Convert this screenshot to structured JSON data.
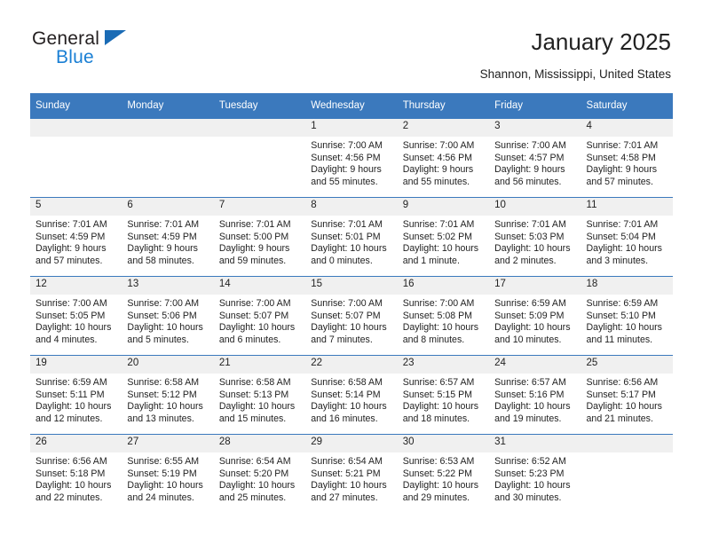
{
  "brand": {
    "name_top": "General",
    "name_bottom": "Blue",
    "accent_color": "#1a7fd4",
    "triangle_color": "#1a6bb5"
  },
  "header": {
    "title": "January 2025",
    "subtitle": "Shannon, Mississippi, United States"
  },
  "calendar": {
    "header_bg": "#3b79bd",
    "daynum_band_bg": "#f0f0f0",
    "weekday_headers": [
      "Sunday",
      "Monday",
      "Tuesday",
      "Wednesday",
      "Thursday",
      "Friday",
      "Saturday"
    ],
    "weeks": [
      [
        {
          "day": "",
          "empty": true
        },
        {
          "day": "",
          "empty": true
        },
        {
          "day": "",
          "empty": true
        },
        {
          "day": "1",
          "sunrise": "Sunrise: 7:00 AM",
          "sunset": "Sunset: 4:56 PM",
          "daylight_line1": "Daylight: 9 hours",
          "daylight_line2": "and 55 minutes."
        },
        {
          "day": "2",
          "sunrise": "Sunrise: 7:00 AM",
          "sunset": "Sunset: 4:56 PM",
          "daylight_line1": "Daylight: 9 hours",
          "daylight_line2": "and 55 minutes."
        },
        {
          "day": "3",
          "sunrise": "Sunrise: 7:00 AM",
          "sunset": "Sunset: 4:57 PM",
          "daylight_line1": "Daylight: 9 hours",
          "daylight_line2": "and 56 minutes."
        },
        {
          "day": "4",
          "sunrise": "Sunrise: 7:01 AM",
          "sunset": "Sunset: 4:58 PM",
          "daylight_line1": "Daylight: 9 hours",
          "daylight_line2": "and 57 minutes."
        }
      ],
      [
        {
          "day": "5",
          "sunrise": "Sunrise: 7:01 AM",
          "sunset": "Sunset: 4:59 PM",
          "daylight_line1": "Daylight: 9 hours",
          "daylight_line2": "and 57 minutes."
        },
        {
          "day": "6",
          "sunrise": "Sunrise: 7:01 AM",
          "sunset": "Sunset: 4:59 PM",
          "daylight_line1": "Daylight: 9 hours",
          "daylight_line2": "and 58 minutes."
        },
        {
          "day": "7",
          "sunrise": "Sunrise: 7:01 AM",
          "sunset": "Sunset: 5:00 PM",
          "daylight_line1": "Daylight: 9 hours",
          "daylight_line2": "and 59 minutes."
        },
        {
          "day": "8",
          "sunrise": "Sunrise: 7:01 AM",
          "sunset": "Sunset: 5:01 PM",
          "daylight_line1": "Daylight: 10 hours",
          "daylight_line2": "and 0 minutes."
        },
        {
          "day": "9",
          "sunrise": "Sunrise: 7:01 AM",
          "sunset": "Sunset: 5:02 PM",
          "daylight_line1": "Daylight: 10 hours",
          "daylight_line2": "and 1 minute."
        },
        {
          "day": "10",
          "sunrise": "Sunrise: 7:01 AM",
          "sunset": "Sunset: 5:03 PM",
          "daylight_line1": "Daylight: 10 hours",
          "daylight_line2": "and 2 minutes."
        },
        {
          "day": "11",
          "sunrise": "Sunrise: 7:01 AM",
          "sunset": "Sunset: 5:04 PM",
          "daylight_line1": "Daylight: 10 hours",
          "daylight_line2": "and 3 minutes."
        }
      ],
      [
        {
          "day": "12",
          "sunrise": "Sunrise: 7:00 AM",
          "sunset": "Sunset: 5:05 PM",
          "daylight_line1": "Daylight: 10 hours",
          "daylight_line2": "and 4 minutes."
        },
        {
          "day": "13",
          "sunrise": "Sunrise: 7:00 AM",
          "sunset": "Sunset: 5:06 PM",
          "daylight_line1": "Daylight: 10 hours",
          "daylight_line2": "and 5 minutes."
        },
        {
          "day": "14",
          "sunrise": "Sunrise: 7:00 AM",
          "sunset": "Sunset: 5:07 PM",
          "daylight_line1": "Daylight: 10 hours",
          "daylight_line2": "and 6 minutes."
        },
        {
          "day": "15",
          "sunrise": "Sunrise: 7:00 AM",
          "sunset": "Sunset: 5:07 PM",
          "daylight_line1": "Daylight: 10 hours",
          "daylight_line2": "and 7 minutes."
        },
        {
          "day": "16",
          "sunrise": "Sunrise: 7:00 AM",
          "sunset": "Sunset: 5:08 PM",
          "daylight_line1": "Daylight: 10 hours",
          "daylight_line2": "and 8 minutes."
        },
        {
          "day": "17",
          "sunrise": "Sunrise: 6:59 AM",
          "sunset": "Sunset: 5:09 PM",
          "daylight_line1": "Daylight: 10 hours",
          "daylight_line2": "and 10 minutes."
        },
        {
          "day": "18",
          "sunrise": "Sunrise: 6:59 AM",
          "sunset": "Sunset: 5:10 PM",
          "daylight_line1": "Daylight: 10 hours",
          "daylight_line2": "and 11 minutes."
        }
      ],
      [
        {
          "day": "19",
          "sunrise": "Sunrise: 6:59 AM",
          "sunset": "Sunset: 5:11 PM",
          "daylight_line1": "Daylight: 10 hours",
          "daylight_line2": "and 12 minutes."
        },
        {
          "day": "20",
          "sunrise": "Sunrise: 6:58 AM",
          "sunset": "Sunset: 5:12 PM",
          "daylight_line1": "Daylight: 10 hours",
          "daylight_line2": "and 13 minutes."
        },
        {
          "day": "21",
          "sunrise": "Sunrise: 6:58 AM",
          "sunset": "Sunset: 5:13 PM",
          "daylight_line1": "Daylight: 10 hours",
          "daylight_line2": "and 15 minutes."
        },
        {
          "day": "22",
          "sunrise": "Sunrise: 6:58 AM",
          "sunset": "Sunset: 5:14 PM",
          "daylight_line1": "Daylight: 10 hours",
          "daylight_line2": "and 16 minutes."
        },
        {
          "day": "23",
          "sunrise": "Sunrise: 6:57 AM",
          "sunset": "Sunset: 5:15 PM",
          "daylight_line1": "Daylight: 10 hours",
          "daylight_line2": "and 18 minutes."
        },
        {
          "day": "24",
          "sunrise": "Sunrise: 6:57 AM",
          "sunset": "Sunset: 5:16 PM",
          "daylight_line1": "Daylight: 10 hours",
          "daylight_line2": "and 19 minutes."
        },
        {
          "day": "25",
          "sunrise": "Sunrise: 6:56 AM",
          "sunset": "Sunset: 5:17 PM",
          "daylight_line1": "Daylight: 10 hours",
          "daylight_line2": "and 21 minutes."
        }
      ],
      [
        {
          "day": "26",
          "sunrise": "Sunrise: 6:56 AM",
          "sunset": "Sunset: 5:18 PM",
          "daylight_line1": "Daylight: 10 hours",
          "daylight_line2": "and 22 minutes."
        },
        {
          "day": "27",
          "sunrise": "Sunrise: 6:55 AM",
          "sunset": "Sunset: 5:19 PM",
          "daylight_line1": "Daylight: 10 hours",
          "daylight_line2": "and 24 minutes."
        },
        {
          "day": "28",
          "sunrise": "Sunrise: 6:54 AM",
          "sunset": "Sunset: 5:20 PM",
          "daylight_line1": "Daylight: 10 hours",
          "daylight_line2": "and 25 minutes."
        },
        {
          "day": "29",
          "sunrise": "Sunrise: 6:54 AM",
          "sunset": "Sunset: 5:21 PM",
          "daylight_line1": "Daylight: 10 hours",
          "daylight_line2": "and 27 minutes."
        },
        {
          "day": "30",
          "sunrise": "Sunrise: 6:53 AM",
          "sunset": "Sunset: 5:22 PM",
          "daylight_line1": "Daylight: 10 hours",
          "daylight_line2": "and 29 minutes."
        },
        {
          "day": "31",
          "sunrise": "Sunrise: 6:52 AM",
          "sunset": "Sunset: 5:23 PM",
          "daylight_line1": "Daylight: 10 hours",
          "daylight_line2": "and 30 minutes."
        },
        {
          "day": "",
          "empty": true
        }
      ]
    ]
  }
}
